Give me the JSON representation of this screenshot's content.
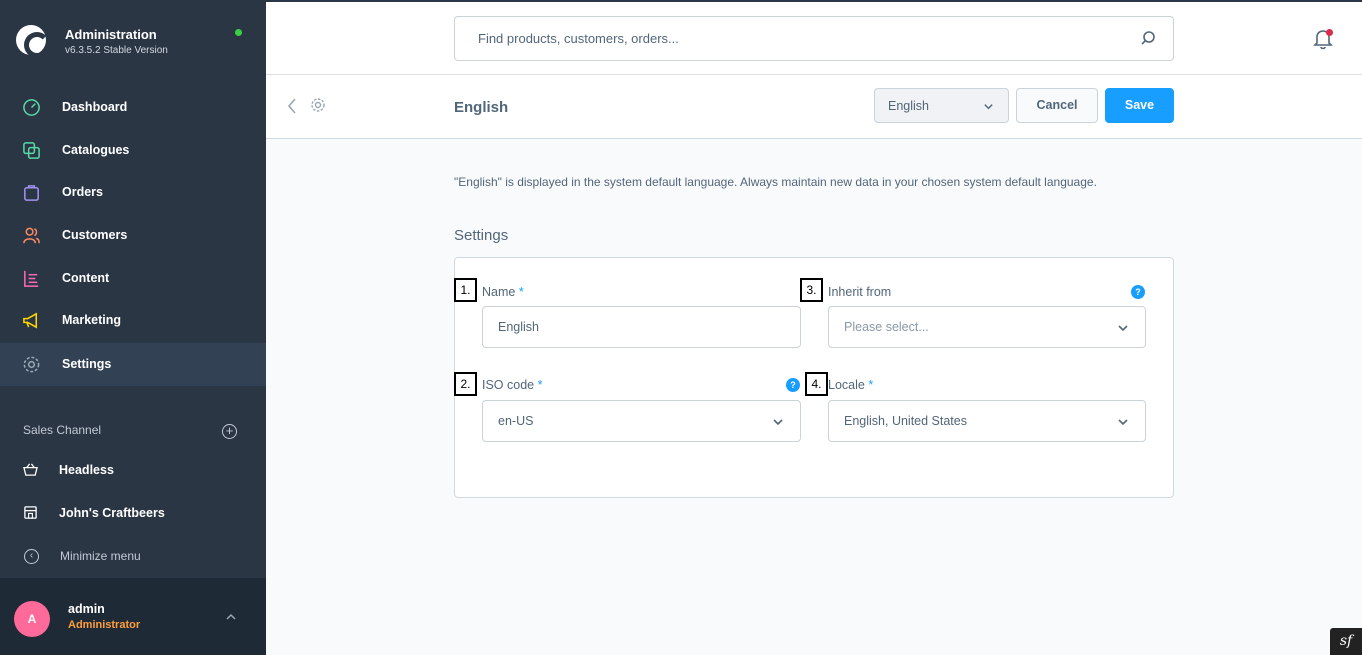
{
  "brand": {
    "title": "Administration",
    "version": "v6.3.5.2 Stable Version"
  },
  "sidebar": {
    "items": [
      {
        "label": "Dashboard",
        "icon": "dashboard-icon",
        "color": "#57d9a3"
      },
      {
        "label": "Catalogues",
        "icon": "catalogues-icon",
        "color": "#57d9a3"
      },
      {
        "label": "Orders",
        "icon": "orders-icon",
        "color": "#a092f0"
      },
      {
        "label": "Customers",
        "icon": "customers-icon",
        "color": "#f88962"
      },
      {
        "label": "Content",
        "icon": "content-icon",
        "color": "#ff68b4"
      },
      {
        "label": "Marketing",
        "icon": "marketing-icon",
        "color": "#ffd700"
      },
      {
        "label": "Settings",
        "icon": "settings-icon",
        "color": "#9aa8b5",
        "active": true
      }
    ],
    "sales_channel_label": "Sales Channel",
    "channels": [
      {
        "label": "Headless",
        "icon": "basket-icon"
      },
      {
        "label": "John's Craftbeers",
        "icon": "storefront-icon"
      }
    ],
    "minimize_label": "Minimize menu",
    "user": {
      "initial": "A",
      "name": "admin",
      "role": "Administrator"
    }
  },
  "search": {
    "placeholder": "Find products, customers, orders..."
  },
  "smartbar": {
    "title": "English",
    "language_select": "English",
    "cancel_label": "Cancel",
    "save_label": "Save"
  },
  "main": {
    "notice": "\"English\" is displayed in the system default language. Always maintain new data in your chosen system default language.",
    "settings_heading": "Settings",
    "fields": {
      "name": {
        "marker": "1.",
        "label": "Name",
        "required": "*",
        "value": "English"
      },
      "iso_code": {
        "marker": "2.",
        "label": "ISO code",
        "required": "*",
        "value": "en-US",
        "help": "?"
      },
      "inherit_from": {
        "marker": "3.",
        "label": "Inherit from",
        "placeholder": "Please select...",
        "help": "?"
      },
      "locale": {
        "marker": "4.",
        "label": "Locale",
        "required": "*",
        "value": "English, United States"
      }
    }
  },
  "colors": {
    "accent": "#189eff",
    "sidebar_bg": "#2b3645",
    "status_online": "#37d046",
    "notification": "#de294c",
    "role": "#ff9d3d"
  }
}
